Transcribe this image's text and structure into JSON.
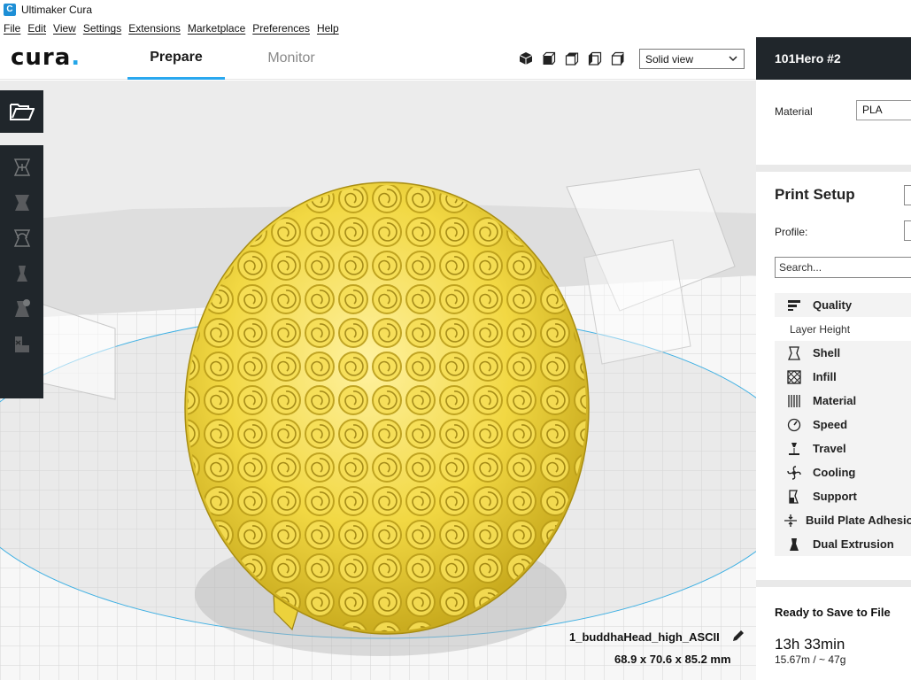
{
  "window": {
    "title": "Ultimaker Cura"
  },
  "menubar": {
    "items": [
      "File",
      "Edit",
      "View",
      "Settings",
      "Extensions",
      "Marketplace",
      "Preferences",
      "Help"
    ]
  },
  "header": {
    "logo": "cura",
    "tabs": [
      {
        "label": "Prepare",
        "active": true
      },
      {
        "label": "Monitor",
        "active": false
      }
    ],
    "view_icons": [
      "3d-view-icon",
      "front-view-icon",
      "top-view-icon",
      "left-view-icon",
      "right-view-icon"
    ],
    "view_mode": "Solid view"
  },
  "toolbar": {
    "open_icon": "folder-open-icon",
    "tools": [
      "move-tool-icon",
      "scale-tool-icon",
      "rotate-tool-icon",
      "mirror-tool-icon",
      "per-model-settings-icon",
      "support-blocker-icon"
    ]
  },
  "model": {
    "name": "1_buddhaHead_high_ASCII",
    "dimensions": "68.9 x 70.6 x 85.2 mm",
    "color": "#f2d843"
  },
  "right_panel": {
    "printer_name": "101Hero #2",
    "material_label": "Material",
    "material_value": "PLA",
    "print_setup_title": "Print Setup",
    "profile_label": "Profile:",
    "search_placeholder": "Search...",
    "categories": [
      {
        "label": "Quality",
        "icon": "quality-icon"
      },
      {
        "label": "Shell",
        "icon": "shell-icon"
      },
      {
        "label": "Infill",
        "icon": "infill-icon"
      },
      {
        "label": "Material",
        "icon": "material-icon"
      },
      {
        "label": "Speed",
        "icon": "speed-icon"
      },
      {
        "label": "Travel",
        "icon": "travel-icon"
      },
      {
        "label": "Cooling",
        "icon": "cooling-icon"
      },
      {
        "label": "Support",
        "icon": "support-icon"
      },
      {
        "label": "Build Plate Adhesion",
        "icon": "build-plate-adhesion-icon"
      },
      {
        "label": "Dual Extrusion",
        "icon": "dual-extrusion-icon"
      }
    ],
    "quality_sub_setting": "Layer Height",
    "save_status": "Ready to Save to File",
    "print_time": "13h 33min",
    "print_usage": "15.67m / ~ 47g"
  },
  "colors": {
    "accent": "#2aa8ef",
    "panel_dark": "#20262b",
    "model_yellow": "#f2d843"
  }
}
